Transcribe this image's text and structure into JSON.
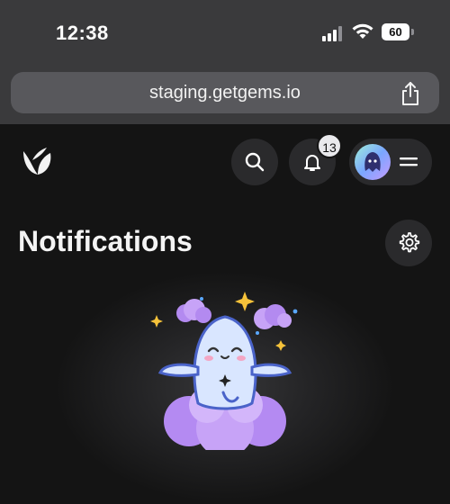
{
  "status_bar": {
    "time": "12:38",
    "battery": "60"
  },
  "browser": {
    "url": "staging.getgems.io"
  },
  "header": {
    "notification_count": "13"
  },
  "page": {
    "title": "Notifications"
  },
  "icons": [
    "signal-icon",
    "wifi-icon",
    "battery-icon",
    "share-icon",
    "getgems-logo-icon",
    "search-icon",
    "bell-icon",
    "avatar",
    "menu-icon",
    "settings-gear-icon",
    "empty-state-ghost-illustration"
  ]
}
